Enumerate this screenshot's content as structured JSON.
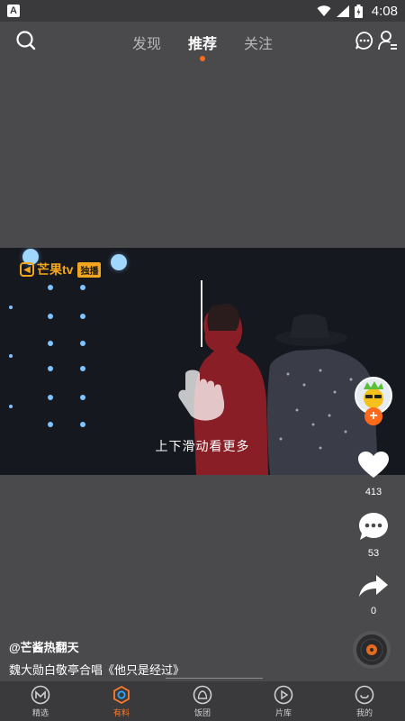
{
  "status_bar": {
    "time": "4:08",
    "notification_badge": "A"
  },
  "top_nav": {
    "tabs": [
      {
        "label": "发现",
        "active": false
      },
      {
        "label": "推荐",
        "active": true
      },
      {
        "label": "关注",
        "active": false
      }
    ]
  },
  "video": {
    "brand": "芒果tv",
    "brand_tag": "独播",
    "swipe_hint": "上下滑动看更多"
  },
  "actions": {
    "likes": "413",
    "comments": "53",
    "shares": "0"
  },
  "post": {
    "author": "@芒酱热翻天",
    "description": "魏大勋白敬亭合唱《他只是经过》"
  },
  "bottom_nav": {
    "items": [
      {
        "label": "精选",
        "icon": "mango-icon",
        "active": false
      },
      {
        "label": "有料",
        "icon": "eye-icon",
        "active": true
      },
      {
        "label": "饭团",
        "icon": "rice-ball-icon",
        "active": false
      },
      {
        "label": "片库",
        "icon": "play-icon",
        "active": false
      },
      {
        "label": "我的",
        "icon": "smile-icon",
        "active": false
      }
    ]
  },
  "colors": {
    "accent": "#ff6a1a",
    "background": "#4a4a4d",
    "bar": "#3a3a3c"
  }
}
